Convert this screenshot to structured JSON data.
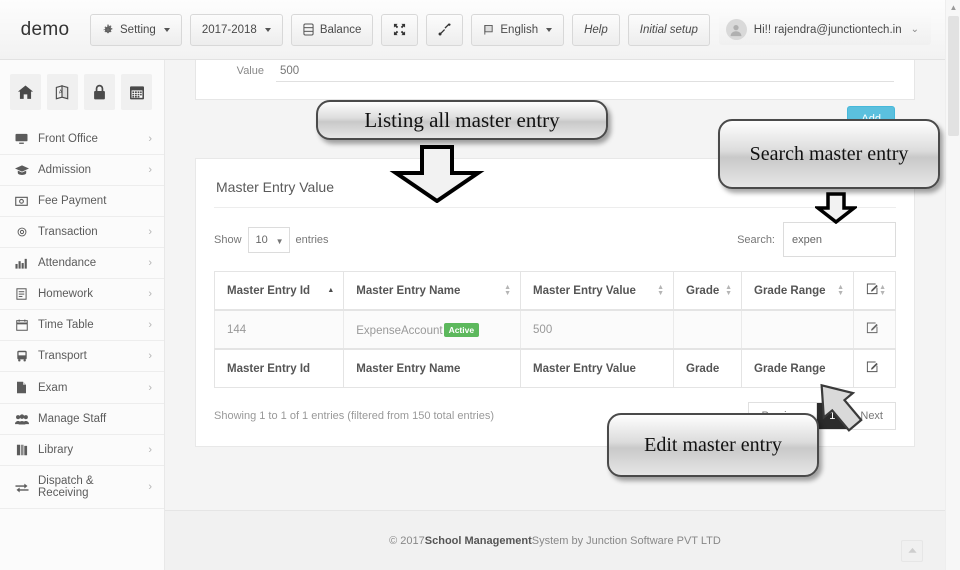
{
  "navbar": {
    "brand": "demo",
    "buttons": [
      {
        "label": "Setting",
        "icon": "gear-icon",
        "caret": true
      },
      {
        "label": "2017-2018",
        "icon": "",
        "caret": true
      },
      {
        "label": "Balance",
        "icon": "database-icon",
        "caret": false
      },
      {
        "label": "",
        "icon": "expand-icon",
        "caret": false
      },
      {
        "label": "",
        "icon": "resize-icon",
        "caret": false
      },
      {
        "label": "English",
        "icon": "flag-icon",
        "caret": true
      },
      {
        "label": "Help",
        "icon": "",
        "caret": false
      },
      {
        "label": "Initial setup",
        "icon": "",
        "caret": false
      }
    ],
    "user": {
      "label": "Hi!! rajendra@junctiontech.in",
      "caret": "⌄"
    }
  },
  "sidebar": {
    "quick_icons": [
      {
        "name": "home-icon"
      },
      {
        "name": "translate-icon"
      },
      {
        "name": "lock-icon"
      },
      {
        "name": "calendar-icon"
      }
    ],
    "items": [
      {
        "label": "Front Office",
        "icon": "monitor-icon",
        "arrow": "›"
      },
      {
        "label": "Admission",
        "icon": "graduation-icon",
        "arrow": "›"
      },
      {
        "label": "Fee Payment",
        "icon": "money-icon",
        "arrow": ""
      },
      {
        "label": "Transaction",
        "icon": "gear-icon",
        "arrow": "›"
      },
      {
        "label": "Attendance",
        "icon": "chart-icon",
        "arrow": "›"
      },
      {
        "label": "Homework",
        "icon": "book-icon",
        "arrow": "›"
      },
      {
        "label": "Time Table",
        "icon": "calendar-icon",
        "arrow": "›"
      },
      {
        "label": "Transport",
        "icon": "bus-icon",
        "arrow": "›"
      },
      {
        "label": "Exam",
        "icon": "file-icon",
        "arrow": "›"
      },
      {
        "label": "Manage Staff",
        "icon": "users-icon",
        "arrow": ""
      },
      {
        "label": "Library",
        "icon": "library-icon",
        "arrow": "›"
      },
      {
        "label": "Dispatch & Receiving",
        "icon": "exchange-icon",
        "arrow": "›"
      }
    ]
  },
  "form": {
    "value_label": "Value",
    "value_text": "500",
    "add_label": "Add"
  },
  "card": {
    "title": "Master Entry Value",
    "show_label": "Show",
    "show_value": "10",
    "entries_label": "entries",
    "search_label": "Search:",
    "search_value": "expen",
    "search_placeholder": "",
    "columns": [
      "Master Entry Id",
      "Master Entry Name",
      "Master Entry Value",
      "Grade",
      "Grade Range",
      ""
    ],
    "rows": [
      {
        "id": "144",
        "name": "ExpenseAccount",
        "badge": "Active",
        "value": "500",
        "grade": "",
        "grade_range": "",
        "edit_icon": "edit-icon"
      }
    ],
    "footer_columns": [
      "Master Entry Id",
      "Master Entry Name",
      "Master Entry Value",
      "Grade",
      "Grade Range",
      ""
    ],
    "info": "Showing 1 to 1 of 1 entries (filtered from 150 total entries)",
    "pagination": [
      "Previous",
      "1",
      "Next"
    ],
    "pagination_active": "1"
  },
  "footer": {
    "prefix": "© 2017 ",
    "bold": "School Management",
    "suffix": " System by Junction Software PVT LTD"
  },
  "annotations": {
    "listing": "Listing all master entry",
    "search": "Search master entry",
    "edit": "Edit master entry"
  },
  "colors": {
    "accent": "#5bc0de",
    "badge_active": "#5cb85c",
    "page_active": "#2b2b2b",
    "page_bg": "#f4f4f4"
  }
}
